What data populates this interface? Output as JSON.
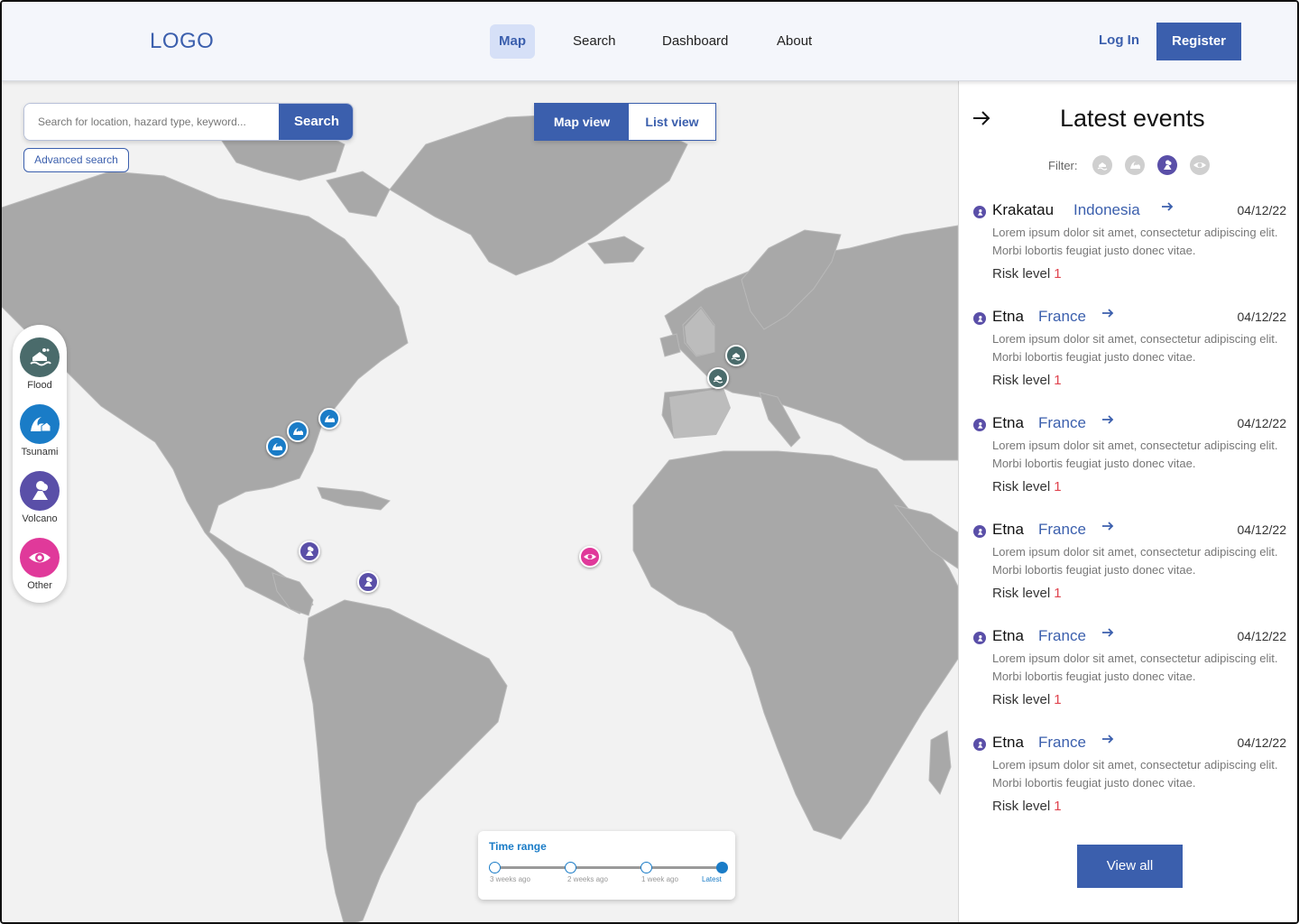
{
  "header": {
    "logo": "LOGO",
    "nav": [
      "Map",
      "Search",
      "Dashboard",
      "About"
    ],
    "login": "Log In",
    "register": "Register"
  },
  "search": {
    "placeholder": "Search for location, hazard type, keyword...",
    "button": "Search",
    "advanced": "Advanced search"
  },
  "view_toggle": {
    "map": "Map view",
    "list": "List view"
  },
  "legend": [
    {
      "label": "Flood",
      "color": "#4a6b6b",
      "icon": "flood-icon"
    },
    {
      "label": "Tsunami",
      "color": "#1a7cc7",
      "icon": "tsunami-icon"
    },
    {
      "label": "Volcano",
      "color": "#5a4fa8",
      "icon": "volcano-icon"
    },
    {
      "label": "Other",
      "color": "#e0399a",
      "icon": "eye-icon"
    }
  ],
  "time_range": {
    "title": "Time range",
    "labels": [
      "3 weeks ago",
      "2 weeks ago",
      "1 week ago",
      "Latest"
    ],
    "selected": "Latest"
  },
  "panel": {
    "title": "Latest events",
    "filter_label": "Filter:",
    "view_all": "View all",
    "events": [
      {
        "name": "Krakatau",
        "country": "Indonesia",
        "date": "04/12/22",
        "desc": "Lorem ipsum dolor sit amet, consectetur adipiscing elit. Morbi lobortis feugiat justo donec vitae.",
        "risk_label": "Risk level",
        "risk": "1"
      },
      {
        "name": "Etna",
        "country": "France",
        "date": "04/12/22",
        "desc": "Lorem ipsum dolor sit amet, consectetur adipiscing elit. Morbi lobortis feugiat justo donec vitae.",
        "risk_label": "Risk level",
        "risk": "1"
      },
      {
        "name": "Etna",
        "country": "France",
        "date": "04/12/22",
        "desc": "Lorem ipsum dolor sit amet, consectetur adipiscing elit. Morbi lobortis feugiat justo donec vitae.",
        "risk_label": "Risk level",
        "risk": "1"
      },
      {
        "name": "Etna",
        "country": "France",
        "date": "04/12/22",
        "desc": "Lorem ipsum dolor sit amet, consectetur adipiscing elit. Morbi lobortis feugiat justo donec vitae.",
        "risk_label": "Risk level",
        "risk": "1"
      },
      {
        "name": "Etna",
        "country": "France",
        "date": "04/12/22",
        "desc": "Lorem ipsum dolor sit amet, consectetur adipiscing elit. Morbi lobortis feugiat justo donec vitae.",
        "risk_label": "Risk level",
        "risk": "1"
      },
      {
        "name": "Etna",
        "country": "France",
        "date": "04/12/22",
        "desc": "Lorem ipsum dolor sit amet, consectetur adipiscing elit. Morbi lobortis feugiat justo donec vitae.",
        "risk_label": "Risk level",
        "risk": "1"
      }
    ]
  },
  "colors": {
    "primary": "#3b5fad",
    "flood": "#4a6b6b",
    "tsunami": "#1a7cc7",
    "volcano": "#5a4fa8",
    "other": "#e0399a",
    "risk": "#e0434e"
  }
}
